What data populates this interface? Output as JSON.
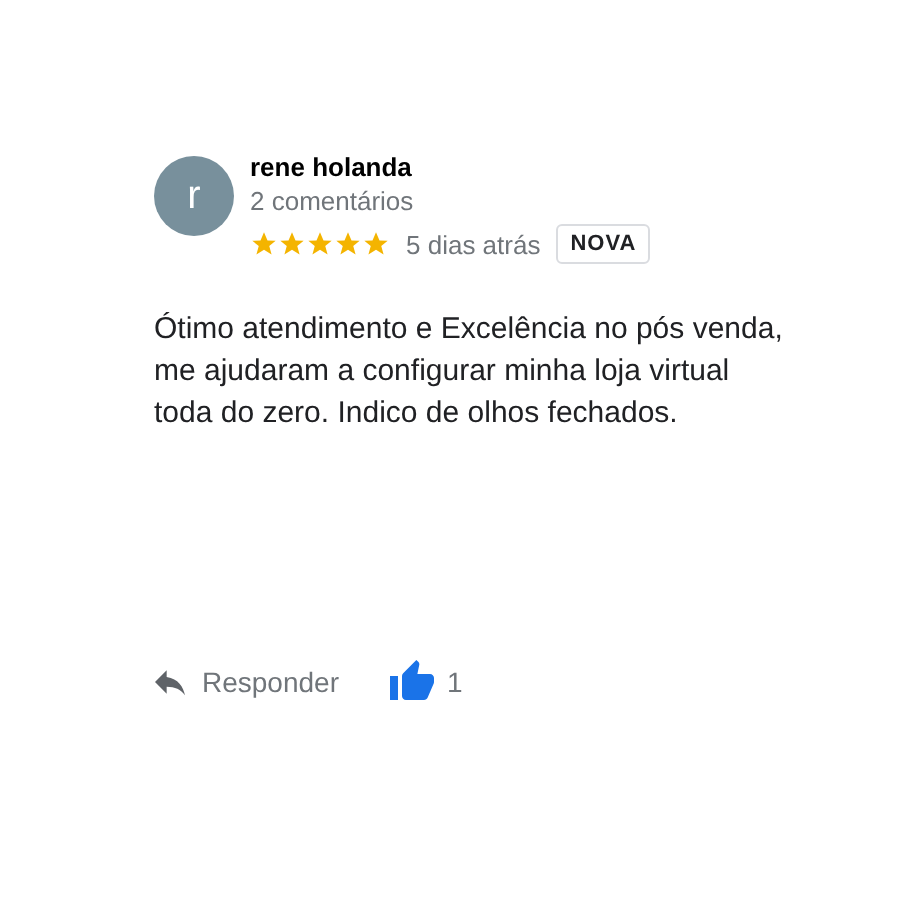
{
  "review": {
    "avatar_letter": "r",
    "author": "rene holanda",
    "comment_count": "2 comentários",
    "stars": 5,
    "time": "5 dias atrás",
    "badge": "NOVA",
    "text": "Ótimo atendimento e Excelência no pós venda, me ajudaram a configurar minha loja virtual toda do zero. Indico de olhos fechados."
  },
  "actions": {
    "reply": "Responder",
    "likes": "1",
    "liked": true
  }
}
